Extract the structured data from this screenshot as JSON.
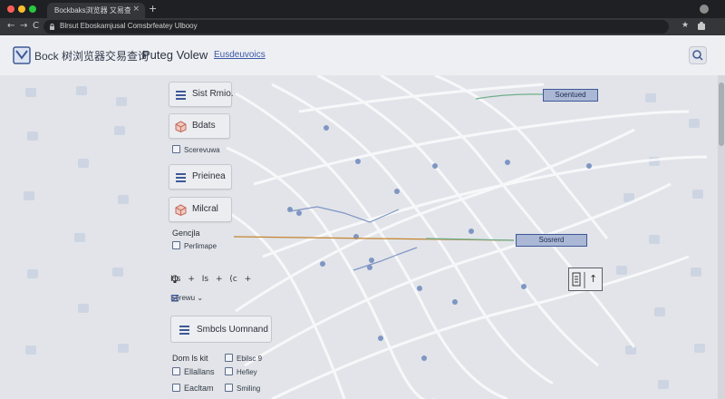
{
  "browser": {
    "tab_title": "Bockbaks浏览器 又易查询",
    "tab_close": "×",
    "new_tab": "+",
    "omnibox_text": "Blrsut Eboskamjusal Comsbrfeatey Ulbooy",
    "nav_back": "←",
    "nav_forward": "→",
    "nav_reload": "C",
    "bookmark_star": "★",
    "traffic_colors": [
      "#ff5f57",
      "#febc2e",
      "#28c840"
    ]
  },
  "app": {
    "title": "Bock 树浏览器交易查询",
    "view_title": "Puteg Volew",
    "header_link": "Eusdeuvoics"
  },
  "palette": {
    "items": [
      {
        "label": "Sist Rmio.",
        "icon": "list-icon"
      },
      {
        "label": "Bdats",
        "icon": "cube-icon"
      },
      {
        "label": "Prieinea",
        "icon": "list-icon"
      },
      {
        "label": "Milcral",
        "icon": "cube-icon"
      }
    ],
    "check_1": "Scerevuwa",
    "section_label": "Gencjla",
    "check_2": "Perlimape",
    "tools": [
      "Hs",
      "+",
      "Is",
      "+",
      "(c",
      "+"
    ],
    "dropdown_label": "Serewu",
    "dropdown_caret": "⌄",
    "big_item": "Smbcls Uomnand",
    "list_header_left": "Dom ls kit",
    "list_header_right": "Ebilsc 9",
    "list_left": [
      "Ellallans",
      "Eacltam"
    ],
    "list_right": [
      "Hefiey",
      "Smiling"
    ]
  },
  "canvas": {
    "node_1": "Soentued",
    "node_2": "Sosrerd",
    "mini_panel_glyph": "↑"
  },
  "colors": {
    "accent": "#3f5996",
    "node_fill": "#aab8d6",
    "link_orange": "#c4832f",
    "link_green": "#6fae8a"
  }
}
